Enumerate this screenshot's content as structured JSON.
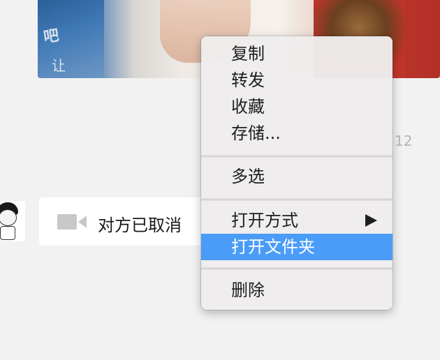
{
  "chat": {
    "image_message": {
      "visible_text_1": "吧",
      "visible_text_2": "让"
    },
    "timestamp": "12",
    "call_message": {
      "icon": "video-camera-icon",
      "text": "对方已取消"
    }
  },
  "context_menu": {
    "items": [
      {
        "label": "复制"
      },
      {
        "label": "转发"
      },
      {
        "label": "收藏"
      },
      {
        "label": "存储..."
      },
      {
        "label": "多选"
      },
      {
        "label": "打开方式",
        "has_submenu": true
      },
      {
        "label": "打开文件夹",
        "highlighted": true
      },
      {
        "label": "删除"
      }
    ]
  },
  "colors": {
    "background": "#f2f2f2",
    "menu_background": "#eeecec",
    "highlight": "#4a9cf8",
    "bubble": "#ffffff",
    "timestamp": "#b5b5b5",
    "icon_gray": "#c8c8c8"
  }
}
